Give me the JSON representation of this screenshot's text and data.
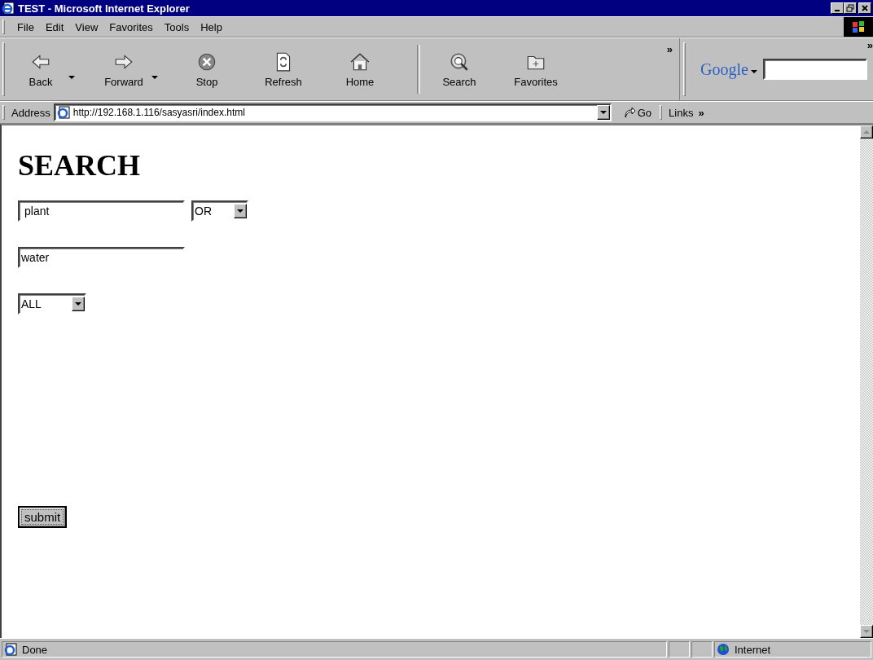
{
  "window": {
    "title": "TEST - Microsoft Internet Explorer"
  },
  "menu": [
    {
      "label": "File"
    },
    {
      "label": "Edit"
    },
    {
      "label": "View"
    },
    {
      "label": "Favorites"
    },
    {
      "label": "Tools"
    },
    {
      "label": "Help"
    }
  ],
  "toolbar": {
    "buttons": [
      {
        "label": "Back",
        "dropdown": true
      },
      {
        "label": "Forward",
        "dropdown": true
      },
      {
        "label": "Stop",
        "dropdown": false
      },
      {
        "label": "Refresh",
        "dropdown": false
      },
      {
        "label": "Home",
        "dropdown": false
      },
      {
        "label": "Search",
        "dropdown": false
      },
      {
        "label": "Favorites",
        "dropdown": false
      }
    ],
    "chevron": "»",
    "google_chevron": "»",
    "google_label": "Google"
  },
  "address_bar": {
    "label": "Address",
    "url": "http://192.168.1.116/sasyasri/index.html",
    "go": "Go",
    "links": "Links",
    "links_chevron": "»"
  },
  "page": {
    "heading": "SEARCH",
    "term_1": {
      "value": "plant"
    },
    "operator": {
      "value": "OR"
    },
    "term_2": {
      "value": "water"
    },
    "scope": {
      "value": "ALL"
    },
    "submit": "submit"
  },
  "status_bar": {
    "text": "Done",
    "zone": "Internet"
  }
}
